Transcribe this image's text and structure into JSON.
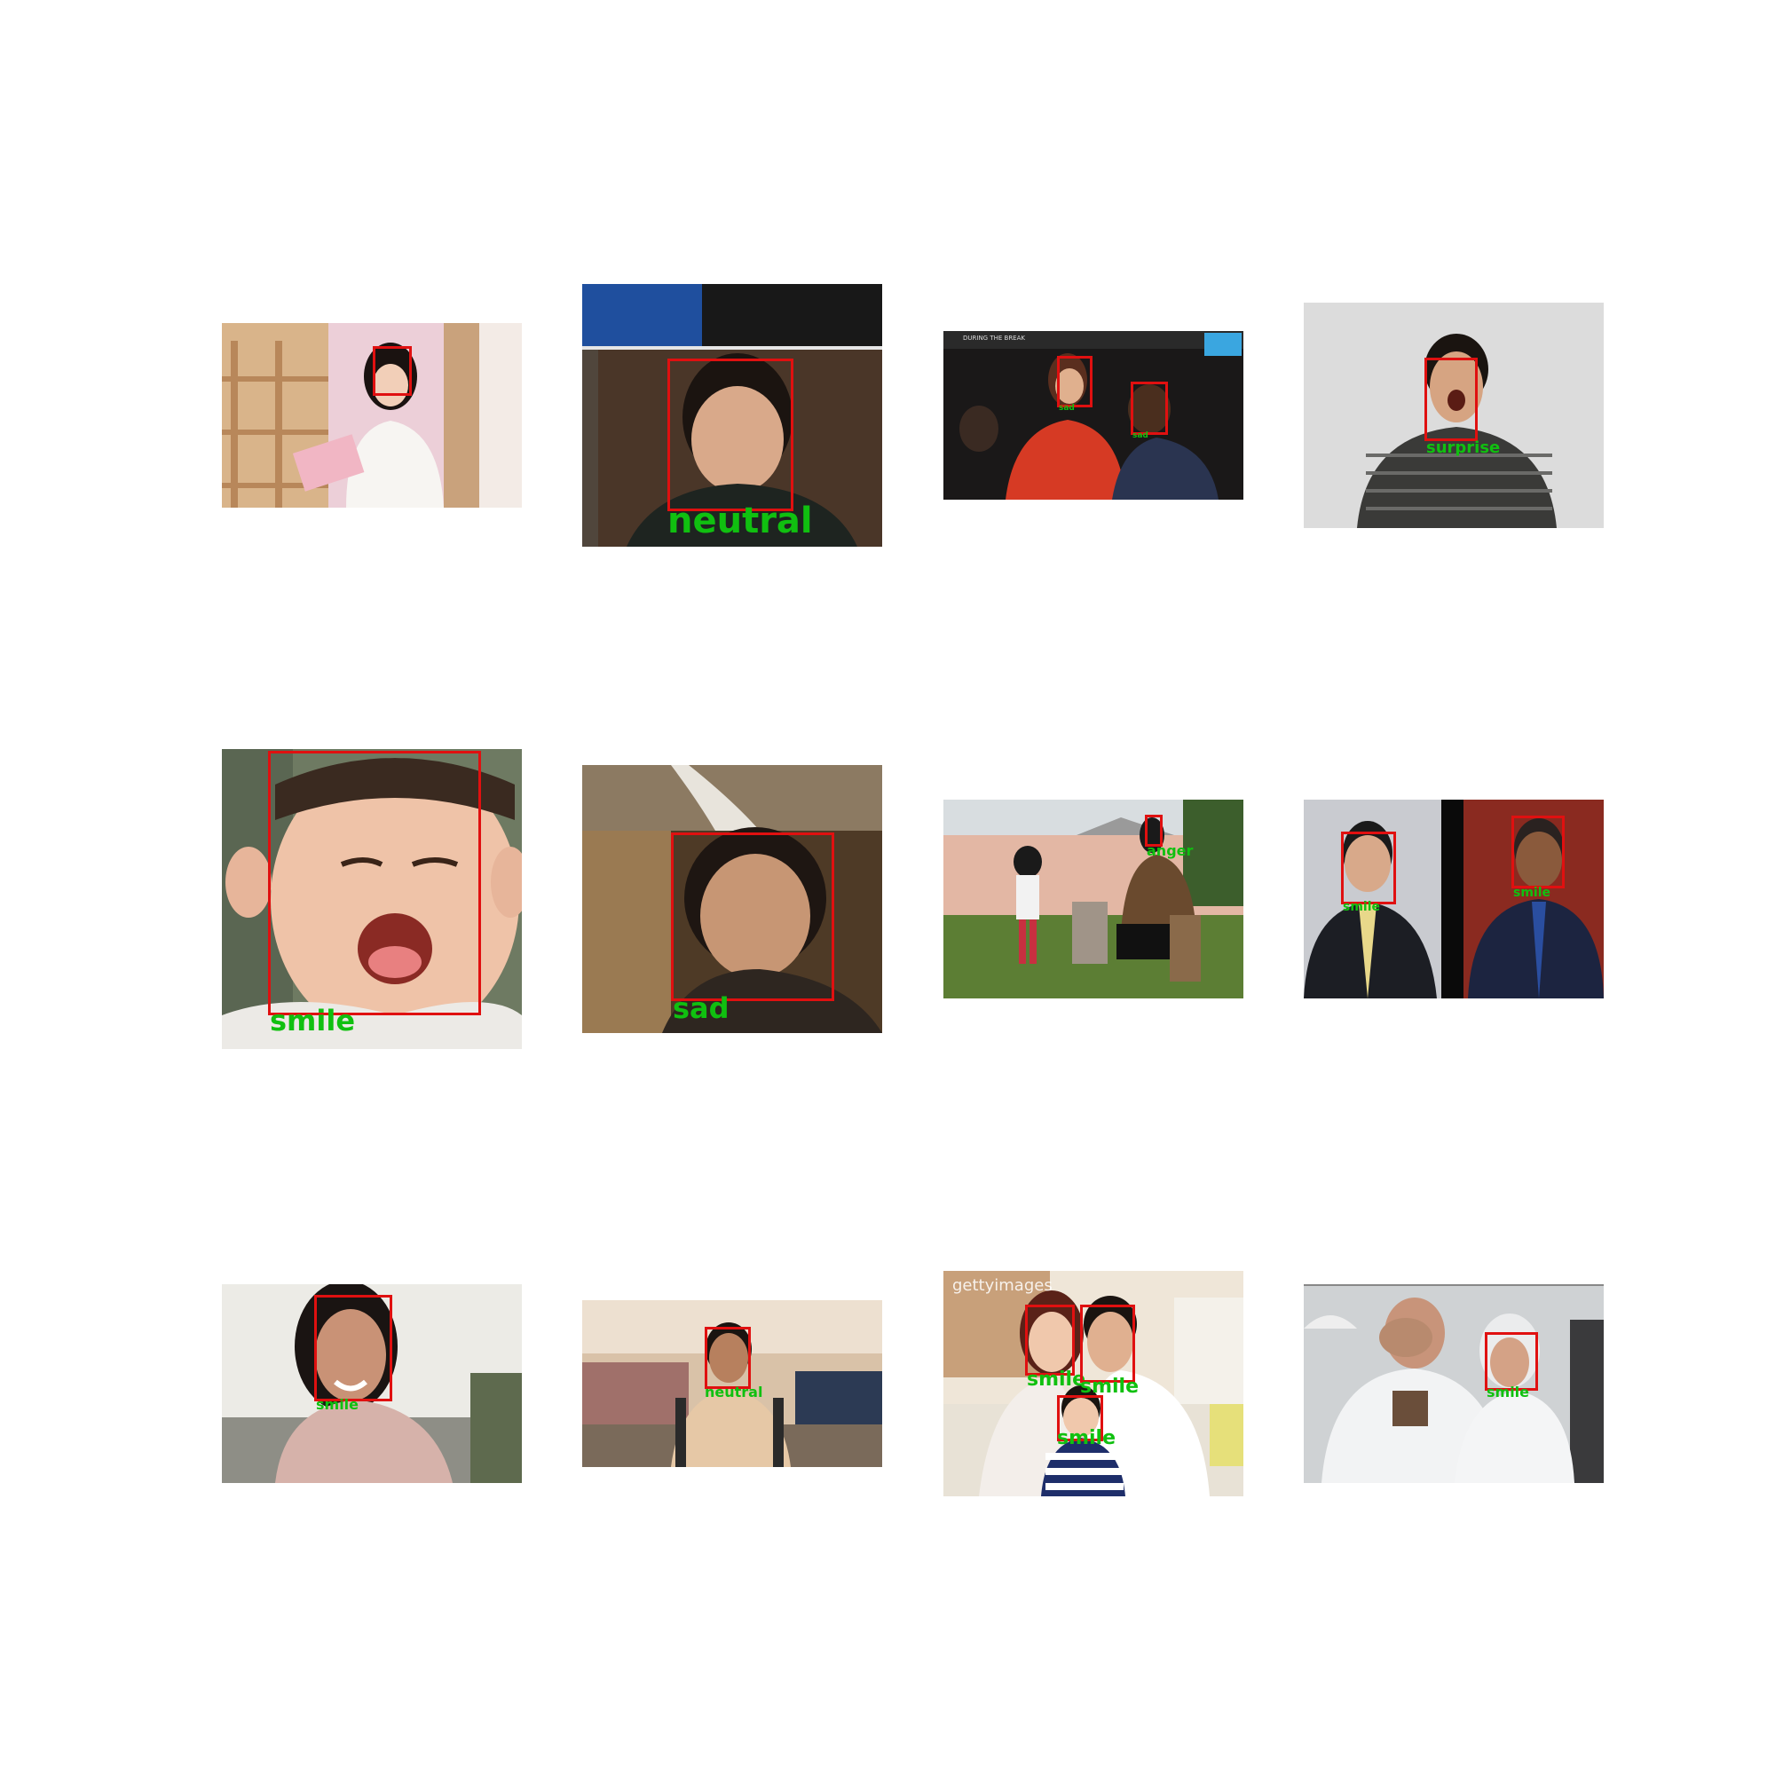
{
  "figure": {
    "tiles": [
      {
        "id": "r1c1",
        "labels": []
      },
      {
        "id": "r1c2",
        "labels": [
          "neutral"
        ]
      },
      {
        "id": "r1c3",
        "labels": [
          "sad",
          "sad"
        ],
        "overlay_text": "DURING THE BREAK"
      },
      {
        "id": "r1c4",
        "labels": [
          "surprise"
        ]
      },
      {
        "id": "r2c1",
        "labels": [
          "smile"
        ]
      },
      {
        "id": "r2c2",
        "labels": [
          "sad"
        ]
      },
      {
        "id": "r2c3",
        "labels": [
          "anger"
        ]
      },
      {
        "id": "r2c4",
        "labels": [
          "smile",
          "smile"
        ]
      },
      {
        "id": "r3c1",
        "labels": [
          "smile"
        ]
      },
      {
        "id": "r3c2",
        "labels": [
          "neutral"
        ]
      },
      {
        "id": "r3c3",
        "labels": [
          "smile",
          "smile",
          "smile"
        ],
        "watermark": "gettyimages"
      },
      {
        "id": "r3c4",
        "labels": [
          "smile"
        ]
      }
    ]
  },
  "colors": {
    "box": "#e01010",
    "label": "#10c010",
    "background": "#ffffff"
  }
}
